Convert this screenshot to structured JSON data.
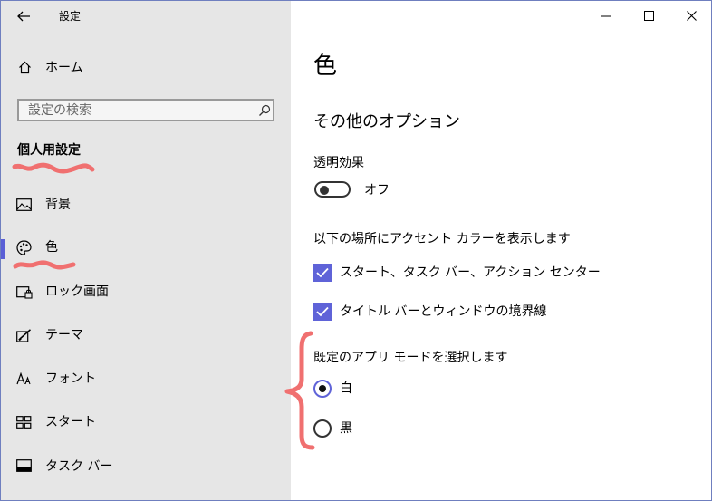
{
  "window": {
    "title": "設定",
    "controls": [
      "minimize",
      "maximize",
      "close"
    ]
  },
  "sidebar": {
    "home_label": "ホーム",
    "search_placeholder": "設定の検索",
    "section_title": "個人用設定",
    "items": [
      {
        "label": "背景",
        "icon": "picture-icon"
      },
      {
        "label": "色",
        "icon": "palette-icon",
        "selected": true
      },
      {
        "label": "ロック画面",
        "icon": "lock-screen-icon"
      },
      {
        "label": "テーマ",
        "icon": "theme-icon"
      },
      {
        "label": "フォント",
        "icon": "font-icon"
      },
      {
        "label": "スタート",
        "icon": "start-icon"
      },
      {
        "label": "タスク バー",
        "icon": "taskbar-icon"
      }
    ]
  },
  "main": {
    "page_title": "色",
    "section_title": "その他のオプション",
    "transparency": {
      "label": "透明効果",
      "state_label": "オフ",
      "on": false
    },
    "accent": {
      "label": "以下の場所にアクセント カラーを表示します",
      "options": [
        {
          "label": "スタート、タスク バー、アクション センター",
          "checked": true
        },
        {
          "label": "タイトル バーとウィンドウの境界線",
          "checked": true
        }
      ]
    },
    "app_mode": {
      "label": "既定のアプリ モードを選択します",
      "options": [
        {
          "label": "白",
          "selected": true
        },
        {
          "label": "黒",
          "selected": false
        }
      ]
    }
  },
  "colors": {
    "accent": "#5f63d8",
    "sidebar_bg": "#e6e6e6",
    "annotation": "#f07070"
  }
}
